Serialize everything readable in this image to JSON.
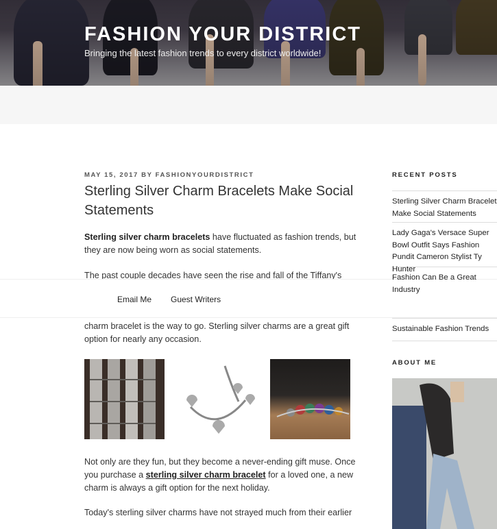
{
  "site": {
    "title": "FASHION YOUR DISTRICT",
    "description": "Bringing the latest fashion trends to every district worldwide!"
  },
  "post": {
    "meta": "MAY 15, 2017 BY FASHIONYOURDISTRICT",
    "title": "Sterling Silver Charm Bracelets Make Social Statements",
    "p1_bold": "Sterling silver charm bracelets",
    "p1_rest": " have fluctuated as fashion trends, but they are now being worn as social statements.",
    "p2": "The past couple decades have seen the rise and fall of the Tiffany's",
    "p3": "charm bracelet is the way to go. Sterling silver charms are a great gift option for nearly any occasion.",
    "p4_a": "Not only are they fun, but they become a never-ending gift muse. Once you purchase a ",
    "p4_link": "sterling silver charm bracelet",
    "p4_b": " for a loved one, a new charm is always a gift option for the next holiday.",
    "p5": "Today's sterling silver charms have not strayed much from their earlier"
  },
  "nav": {
    "email": "Email Me",
    "guest": "Guest Writers"
  },
  "sidebar": {
    "recent_heading": "RECENT POSTS",
    "recent": [
      "Sterling Silver Charm Bracelets Make Social Statements",
      "Lady Gaga's Versace Super Bowl Outfit Says Fashion Pundit Cameron Stylist Ty Hunter",
      "Fashion Can Be a Great Industry",
      "Sustainable Fashion Trends"
    ],
    "about_heading": "ABOUT ME"
  }
}
